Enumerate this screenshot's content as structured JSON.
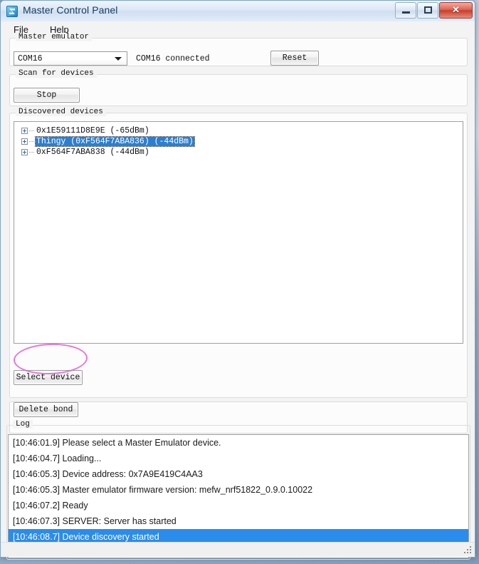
{
  "window": {
    "title": "Master Control Panel",
    "app_icon": "nordic-app-icon",
    "controls": {
      "minimize": "minimize-icon",
      "maximize": "maximize-icon",
      "close": "✕"
    }
  },
  "menubar": {
    "items": [
      {
        "label": "File",
        "name": "menu-file"
      },
      {
        "label": "Help",
        "name": "menu-help"
      }
    ]
  },
  "master_emulator": {
    "legend": "Master emulator",
    "combo_value": "COM16",
    "status_text": "COM16 connected",
    "reset_label": "Reset"
  },
  "scan": {
    "legend": "Scan for devices",
    "stop_label": "Stop"
  },
  "discovered": {
    "legend": "Discovered devices",
    "devices": [
      {
        "label": "0x1E59111D8E9E  (-65dBm)",
        "selected": false
      },
      {
        "label": "Thingy (0xF564F7ABA836) (-44dBm)",
        "selected": true
      },
      {
        "label": "0xF564F7ABA838  (-44dBm)",
        "selected": false
      }
    ],
    "select_device_label": "Select device"
  },
  "bond": {
    "delete_bond_label": "Delete bond"
  },
  "log": {
    "legend": "Log",
    "entries": [
      {
        "text": "[10:46:01.9] Please select a Master Emulator device.",
        "selected": false
      },
      {
        "text": "[10:46:04.7] Loading...",
        "selected": false
      },
      {
        "text": "[10:46:05.3] Device address: 0x7A9E419C4AA3",
        "selected": false
      },
      {
        "text": "[10:46:05.3] Master emulator firmware version: mefw_nrf51822_0.9.0.10022",
        "selected": false
      },
      {
        "text": "[10:46:07.2] Ready",
        "selected": false
      },
      {
        "text": "[10:46:07.3] SERVER: Server has started",
        "selected": false
      },
      {
        "text": "[10:46:08.7] Device discovery started",
        "selected": true
      }
    ]
  },
  "annotation": {
    "shape": "ellipse-highlight",
    "color": "#e05fd0",
    "target": "Select device"
  },
  "colors": {
    "selection_blue": "#2a7fd4",
    "log_selection_blue": "#2a8ced",
    "annotation_magenta": "#e05fd0",
    "close_red": "#c63f2c"
  }
}
